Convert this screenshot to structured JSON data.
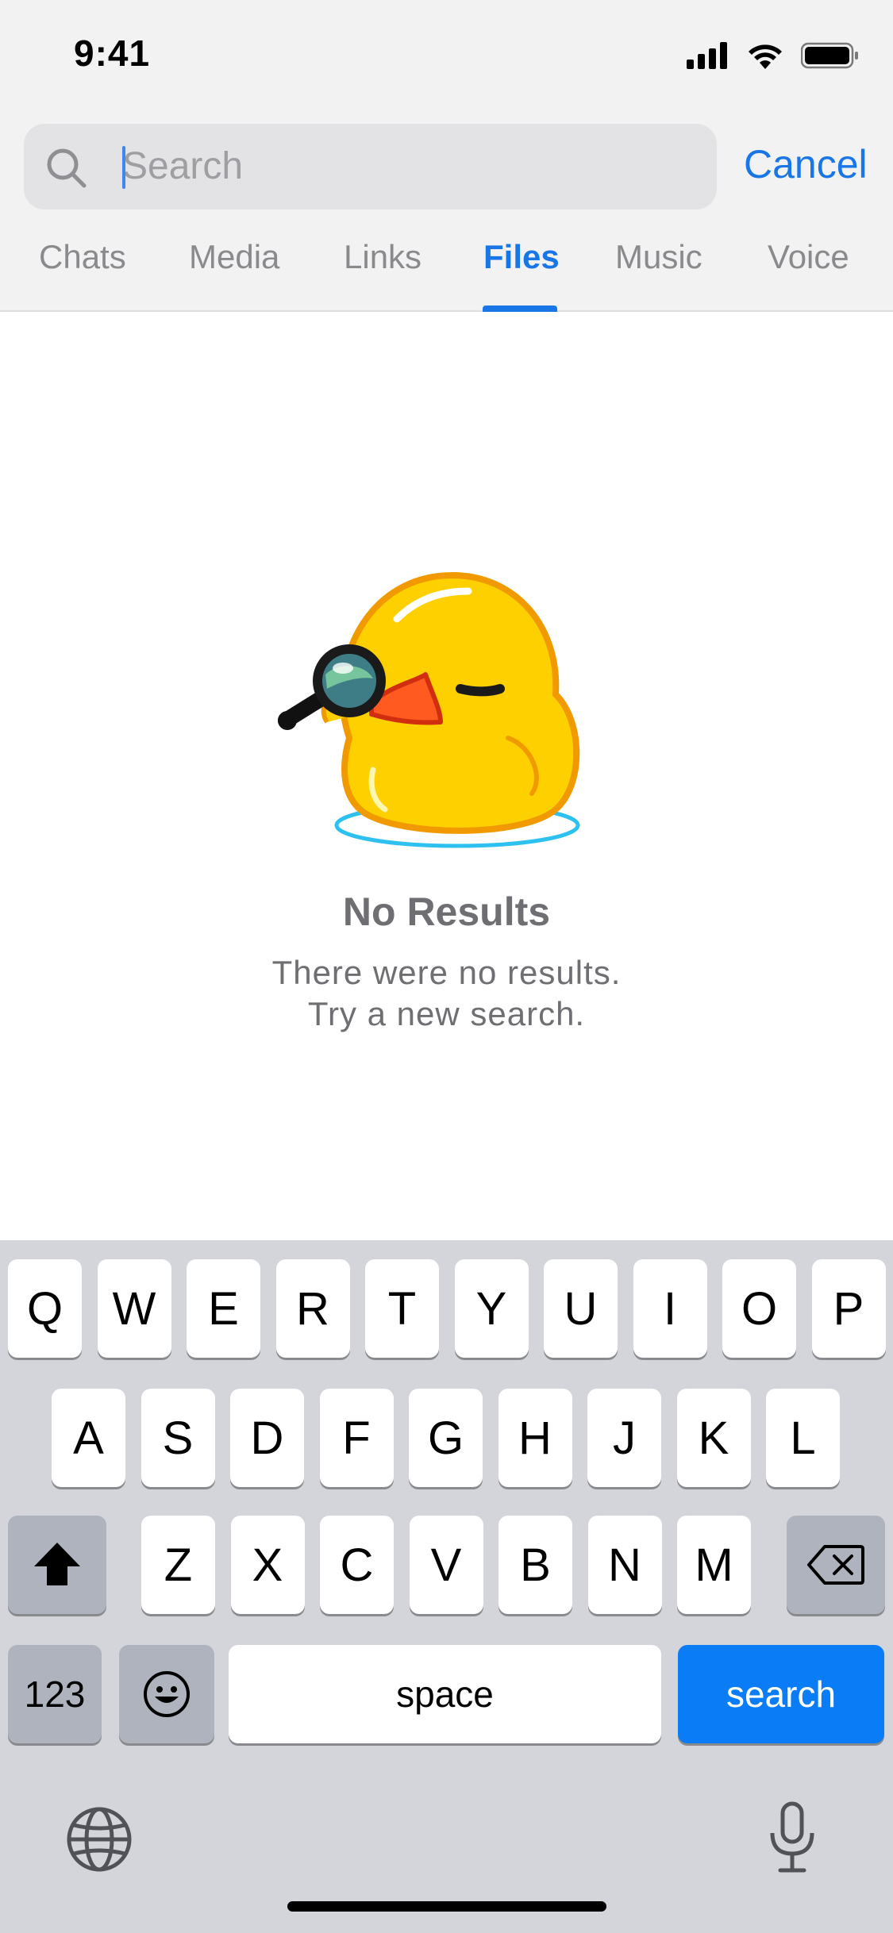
{
  "status_bar": {
    "time": "9:41"
  },
  "search": {
    "placeholder": "Search",
    "cancel_label": "Cancel"
  },
  "tabs": [
    {
      "label": "Chats"
    },
    {
      "label": "Media"
    },
    {
      "label": "Links"
    },
    {
      "label": "Files",
      "active": true
    },
    {
      "label": "Music"
    },
    {
      "label": "Voice"
    }
  ],
  "empty_state": {
    "title": "No Results",
    "line1": "There were no results.",
    "line2": "Try a new search."
  },
  "keyboard": {
    "row1": [
      "Q",
      "W",
      "E",
      "R",
      "T",
      "Y",
      "U",
      "I",
      "O",
      "P"
    ],
    "row2": [
      "A",
      "S",
      "D",
      "F",
      "G",
      "H",
      "J",
      "K",
      "L"
    ],
    "row3": [
      "Z",
      "X",
      "C",
      "V",
      "B",
      "N",
      "M"
    ],
    "numbers_label": "123",
    "space_label": "space",
    "action_label": "search"
  },
  "colors": {
    "accent": "#1876e6",
    "key_blue": "#0a7cf5",
    "keyboard_bg": "#d3d5db",
    "duck_yellow": "#ffd000"
  }
}
